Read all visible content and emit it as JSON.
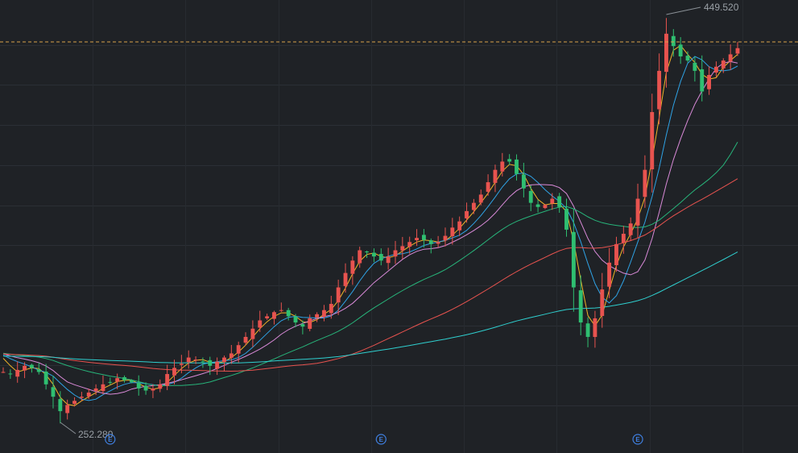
{
  "chart_data": {
    "type": "candlestick",
    "annotations": {
      "high_label": "449.520",
      "low_label": "252.280"
    },
    "reference_line": {
      "value": 434,
      "style": "dashed",
      "color": "#d9a14a"
    },
    "event_markers": [
      {
        "label": "E",
        "index": 15
      },
      {
        "label": "E",
        "index": 53
      },
      {
        "label": "E",
        "index": 89
      }
    ],
    "y_range": [
      248,
      452
    ],
    "candle_colors": {
      "up": "#e8534f",
      "down": "#2fbf71"
    },
    "grid": true,
    "ma_colors": [
      "#f0b429",
      "#2fa3e6",
      "#d98ad8",
      "#27b47a",
      "#e8534f",
      "#2fcfcf"
    ],
    "close_series": [
      274,
      273,
      275,
      277,
      276,
      274,
      268,
      262,
      255,
      258,
      260,
      262,
      264,
      266,
      268,
      269,
      271,
      270,
      269,
      266,
      265,
      266,
      268,
      273,
      276,
      278,
      281,
      280,
      279,
      277,
      279,
      281,
      283,
      287,
      291,
      295,
      299,
      301,
      303,
      304,
      301,
      298,
      296,
      300,
      302,
      304,
      307,
      315,
      322,
      328,
      333,
      332,
      330,
      328,
      330,
      333,
      335,
      337,
      339,
      338,
      336,
      337,
      340,
      344,
      347,
      352,
      356,
      360,
      366,
      372,
      376,
      376,
      370,
      363,
      356,
      354,
      355,
      358,
      354,
      343,
      315,
      298,
      291,
      300,
      314,
      327,
      336,
      341,
      346,
      358,
      372,
      400,
      420,
      438,
      432,
      427,
      425,
      420,
      410,
      418,
      422,
      425,
      428,
      431
    ],
    "window_start_index": 0
  }
}
